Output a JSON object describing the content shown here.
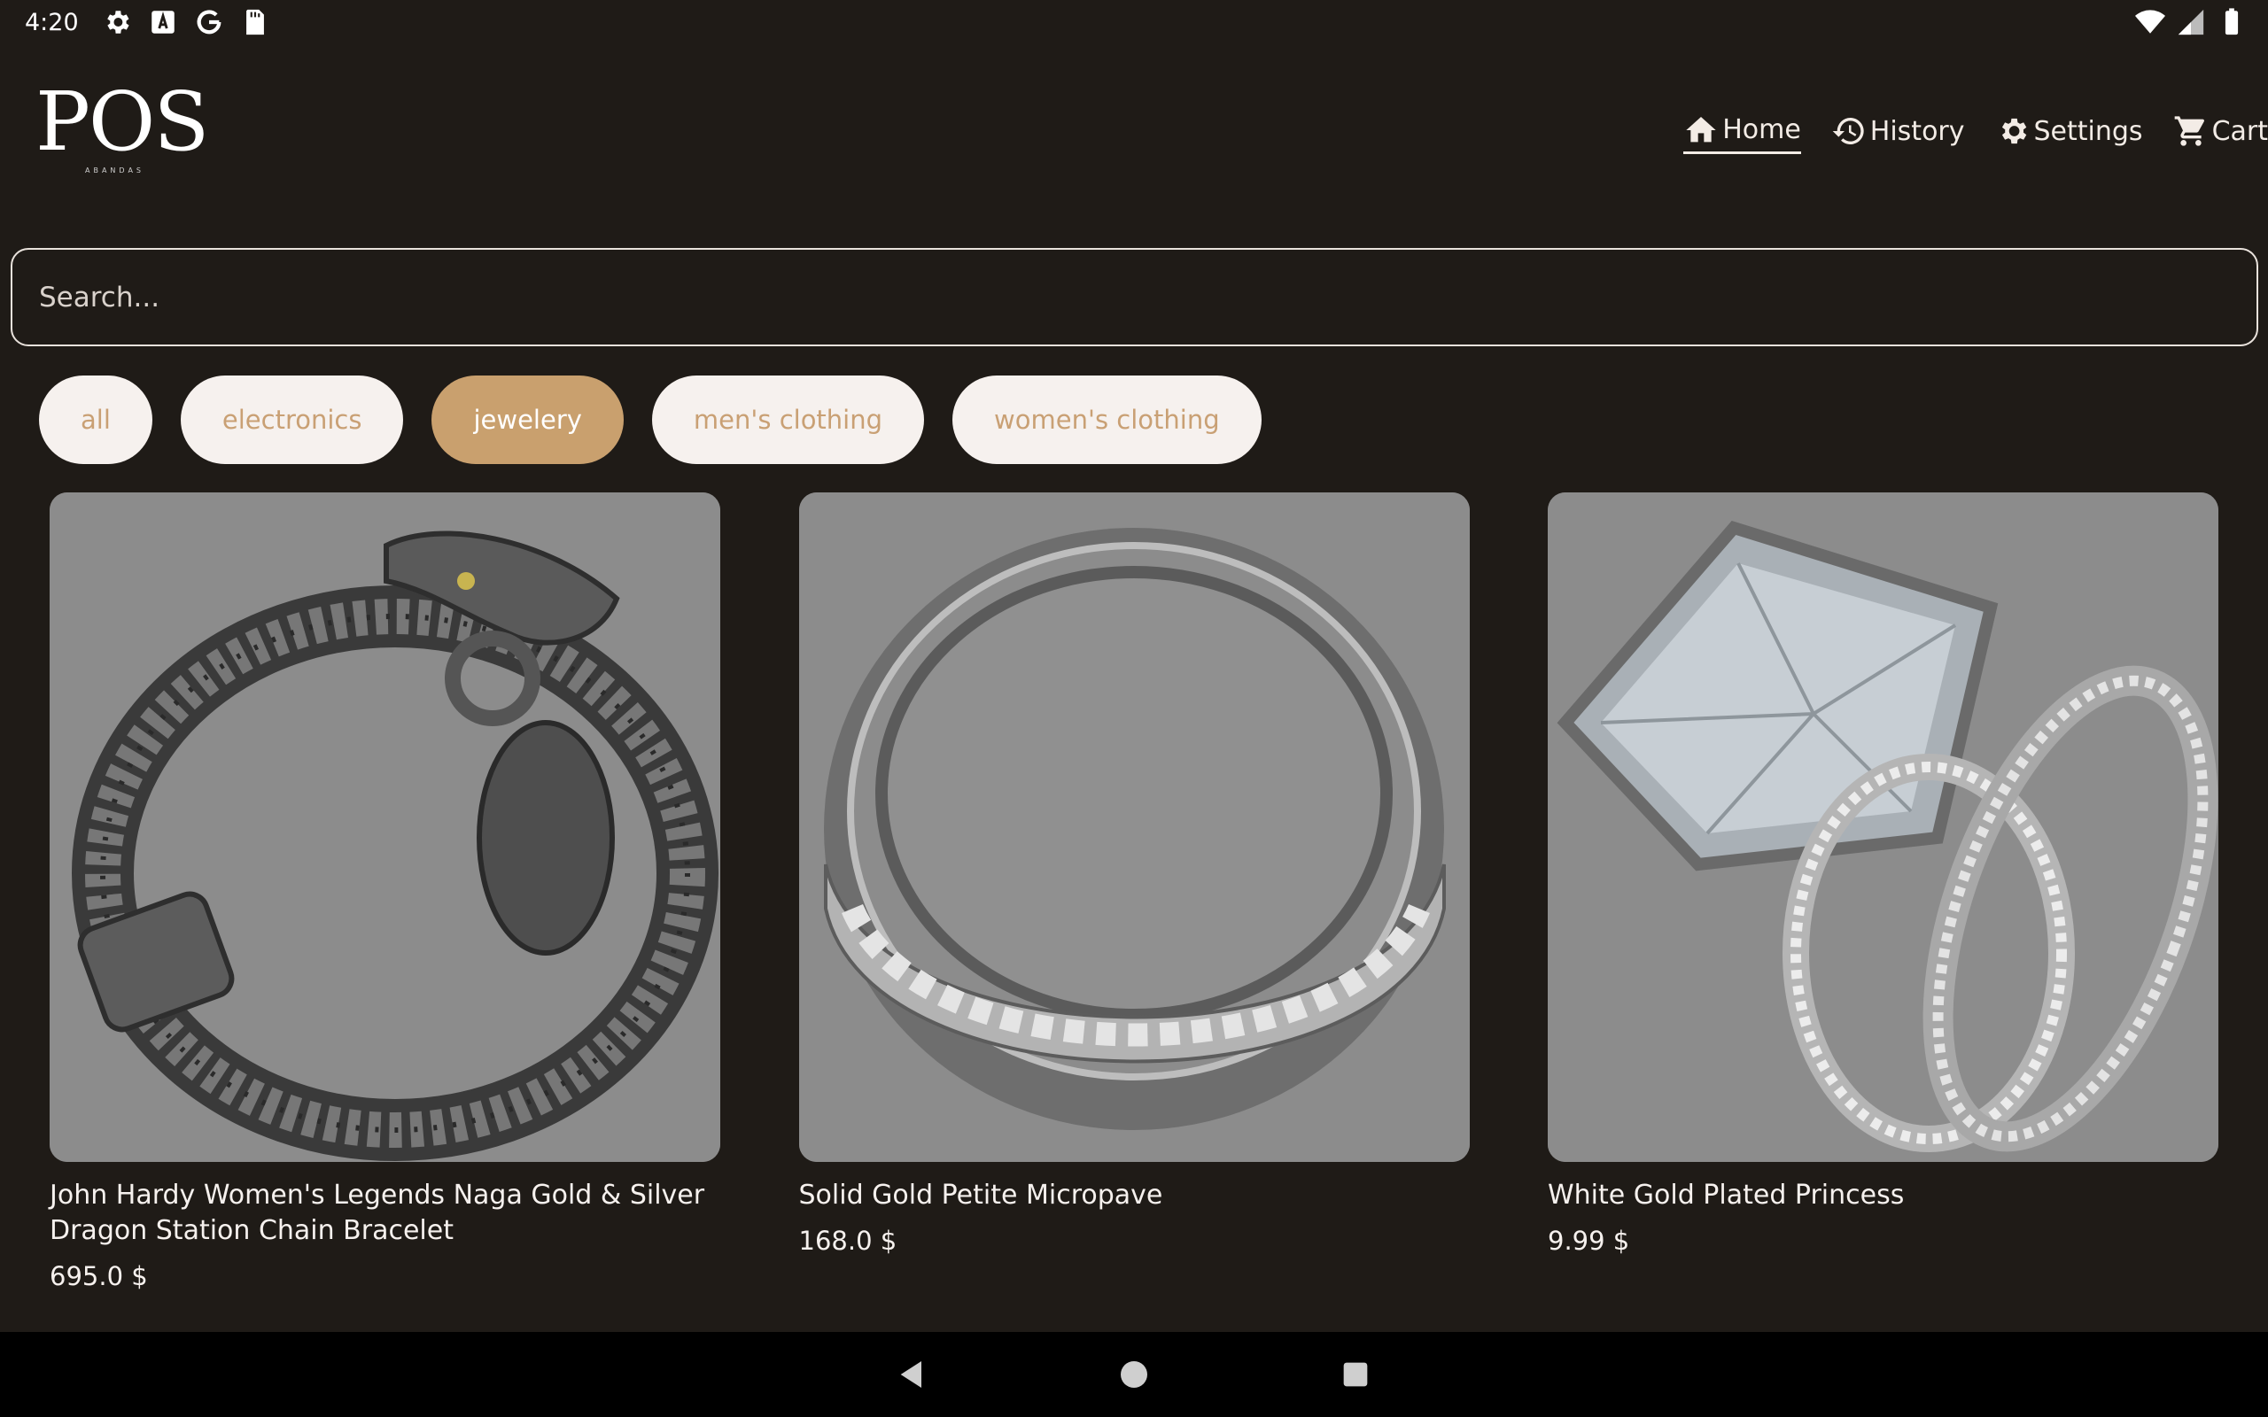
{
  "status_bar": {
    "time": "4:20"
  },
  "header": {
    "logo_text": "POS",
    "logo_subtext": "ABANDAS",
    "nav": [
      {
        "label": "Home",
        "icon": "home-icon",
        "active": true
      },
      {
        "label": "History",
        "icon": "history-icon",
        "active": false
      },
      {
        "label": "Settings",
        "icon": "gear-icon",
        "active": false
      },
      {
        "label": "Cart",
        "icon": "cart-icon",
        "active": false
      }
    ]
  },
  "search": {
    "placeholder": "Search..."
  },
  "categories": {
    "items": [
      "all",
      "electronics",
      "jewelery",
      "men's clothing",
      "women's clothing"
    ],
    "selected": "jewelery"
  },
  "products": [
    {
      "title": "John Hardy Women's Legends Naga Gold & Silver Dragon Station Chain Bracelet",
      "price": "695.0 $",
      "image": "dragon-bracelet-image"
    },
    {
      "title": "Solid Gold Petite Micropave",
      "price": "168.0 $",
      "image": "micropave-ring-image"
    },
    {
      "title": "White Gold Plated Princess",
      "price": "9.99 $",
      "image": "princess-ring-image"
    }
  ],
  "colors": {
    "background": "#1f1b17",
    "accent": "#c9a06e",
    "chip_background": "#f6f1ee",
    "chip_text": "#c9a074",
    "image_background": "#8c8c8c"
  }
}
